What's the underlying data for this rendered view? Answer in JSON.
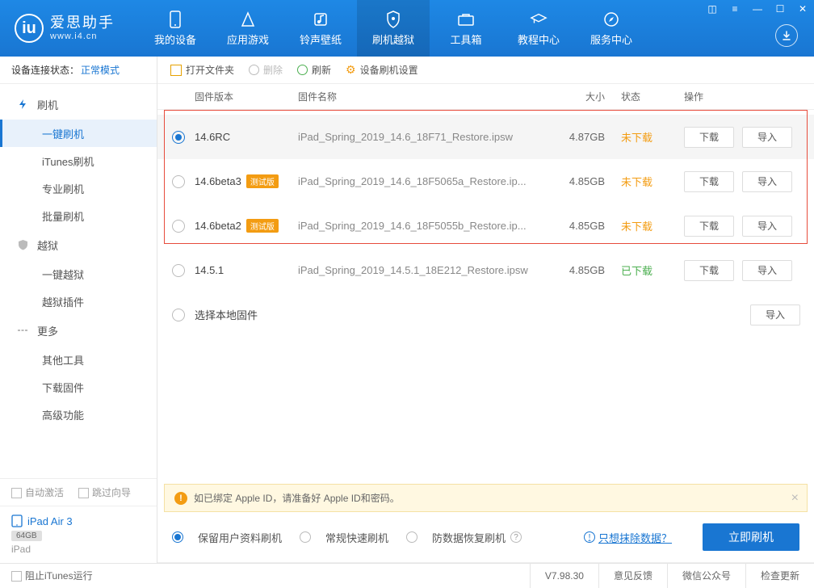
{
  "app": {
    "title": "爱思助手",
    "url": "www.i4.cn"
  },
  "nav": [
    {
      "label": "我的设备"
    },
    {
      "label": "应用游戏"
    },
    {
      "label": "铃声壁纸"
    },
    {
      "label": "刷机越狱"
    },
    {
      "label": "工具箱"
    },
    {
      "label": "教程中心"
    },
    {
      "label": "服务中心"
    }
  ],
  "sidebar": {
    "conn_label": "设备连接状态：",
    "conn_status": "正常模式",
    "groups": [
      {
        "label": "刷机",
        "items": [
          "一键刷机",
          "iTunes刷机",
          "专业刷机",
          "批量刷机"
        ]
      },
      {
        "label": "越狱",
        "items": [
          "一键越狱",
          "越狱插件"
        ]
      },
      {
        "label": "更多",
        "items": [
          "其他工具",
          "下载固件",
          "高级功能"
        ]
      }
    ],
    "auto_activate": "自动激活",
    "skip_guide": "跳过向导",
    "device": {
      "name": "iPad Air 3",
      "storage": "64GB",
      "type": "iPad"
    }
  },
  "toolbar": {
    "open": "打开文件夹",
    "delete": "删除",
    "refresh": "刷新",
    "settings": "设备刷机设置"
  },
  "columns": {
    "version": "固件版本",
    "name": "固件名称",
    "size": "大小",
    "status": "状态",
    "action": "操作"
  },
  "rows": [
    {
      "version": "14.6RC",
      "beta": false,
      "name": "iPad_Spring_2019_14.6_18F71_Restore.ipsw",
      "size": "4.87GB",
      "status": "未下载",
      "status_class": "pending",
      "selected": true,
      "download": "下载",
      "import": "导入"
    },
    {
      "version": "14.6beta3",
      "beta": true,
      "name": "iPad_Spring_2019_14.6_18F5065a_Restore.ip...",
      "size": "4.85GB",
      "status": "未下载",
      "status_class": "pending",
      "selected": false,
      "download": "下载",
      "import": "导入"
    },
    {
      "version": "14.6beta2",
      "beta": true,
      "name": "iPad_Spring_2019_14.6_18F5055b_Restore.ip...",
      "size": "4.85GB",
      "status": "未下载",
      "status_class": "pending",
      "selected": false,
      "download": "下载",
      "import": "导入"
    },
    {
      "version": "14.5.1",
      "beta": false,
      "name": "iPad_Spring_2019_14.5.1_18E212_Restore.ipsw",
      "size": "4.85GB",
      "status": "已下载",
      "status_class": "done",
      "selected": false,
      "download": "下载",
      "import": "导入"
    }
  ],
  "local_fw": {
    "label": "选择本地固件",
    "import": "导入"
  },
  "beta_tag": "测试版",
  "notice": "如已绑定 Apple ID，请准备好 Apple ID和密码。",
  "flash_opts": {
    "keep": "保留用户资料刷机",
    "normal": "常规快速刷机",
    "recovery": "防数据恢复刷机",
    "erase_link": "只想抹除数据？",
    "go": "立即刷机"
  },
  "status": {
    "block_itunes": "阻止iTunes运行",
    "version": "V7.98.30",
    "feedback": "意见反馈",
    "wechat": "微信公众号",
    "update": "检查更新"
  }
}
